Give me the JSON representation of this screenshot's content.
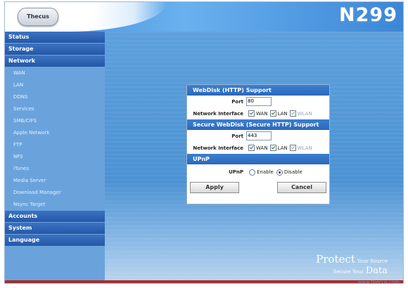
{
  "header": {
    "logo_text": "Thecus",
    "model": "N299"
  },
  "sidebar": {
    "categories": [
      {
        "label": "Status"
      },
      {
        "label": "Storage"
      },
      {
        "label": "Network"
      },
      {
        "label": "Accounts"
      },
      {
        "label": "System"
      },
      {
        "label": "Language"
      }
    ],
    "network_items": [
      "WAN",
      "LAN",
      "DDNS",
      "Services",
      "SMB/CIFS",
      "Apple Network",
      "FTP",
      "NFS",
      "iTunes",
      "Media Server",
      "Download Manager",
      "Nsync Target"
    ]
  },
  "dialog": {
    "webdisk": {
      "title": "WebDisk (HTTP) Support",
      "port_label": "Port",
      "port_value": "80",
      "iface_label": "Network Interface",
      "opt_wan": "WAN",
      "opt_lan": "LAN",
      "opt_wlan": "WLAN"
    },
    "secure": {
      "title": "Secure WebDisk (Secure HTTP) Support",
      "port_label": "Port",
      "port_value": "443",
      "iface_label": "Network Interface",
      "opt_wan": "WAN",
      "opt_lan": "LAN",
      "opt_wlan": "WLAN"
    },
    "upnp": {
      "title": "UPnP",
      "label": "UPnP",
      "enable": "Enable",
      "disable": "Disable",
      "selected": "Disable"
    },
    "buttons": {
      "apply": "Apply",
      "cancel": "Cancel"
    }
  },
  "tagline": {
    "line1": "Protect",
    "line1b": "Your Source",
    "line2": "Secure Your",
    "line3": "Data"
  },
  "footer": {
    "url": "www.thecus.com"
  },
  "colors": {
    "accent": "#2b68ba",
    "sidebar_category": "#2557a6",
    "background": "#5a9ad6"
  }
}
